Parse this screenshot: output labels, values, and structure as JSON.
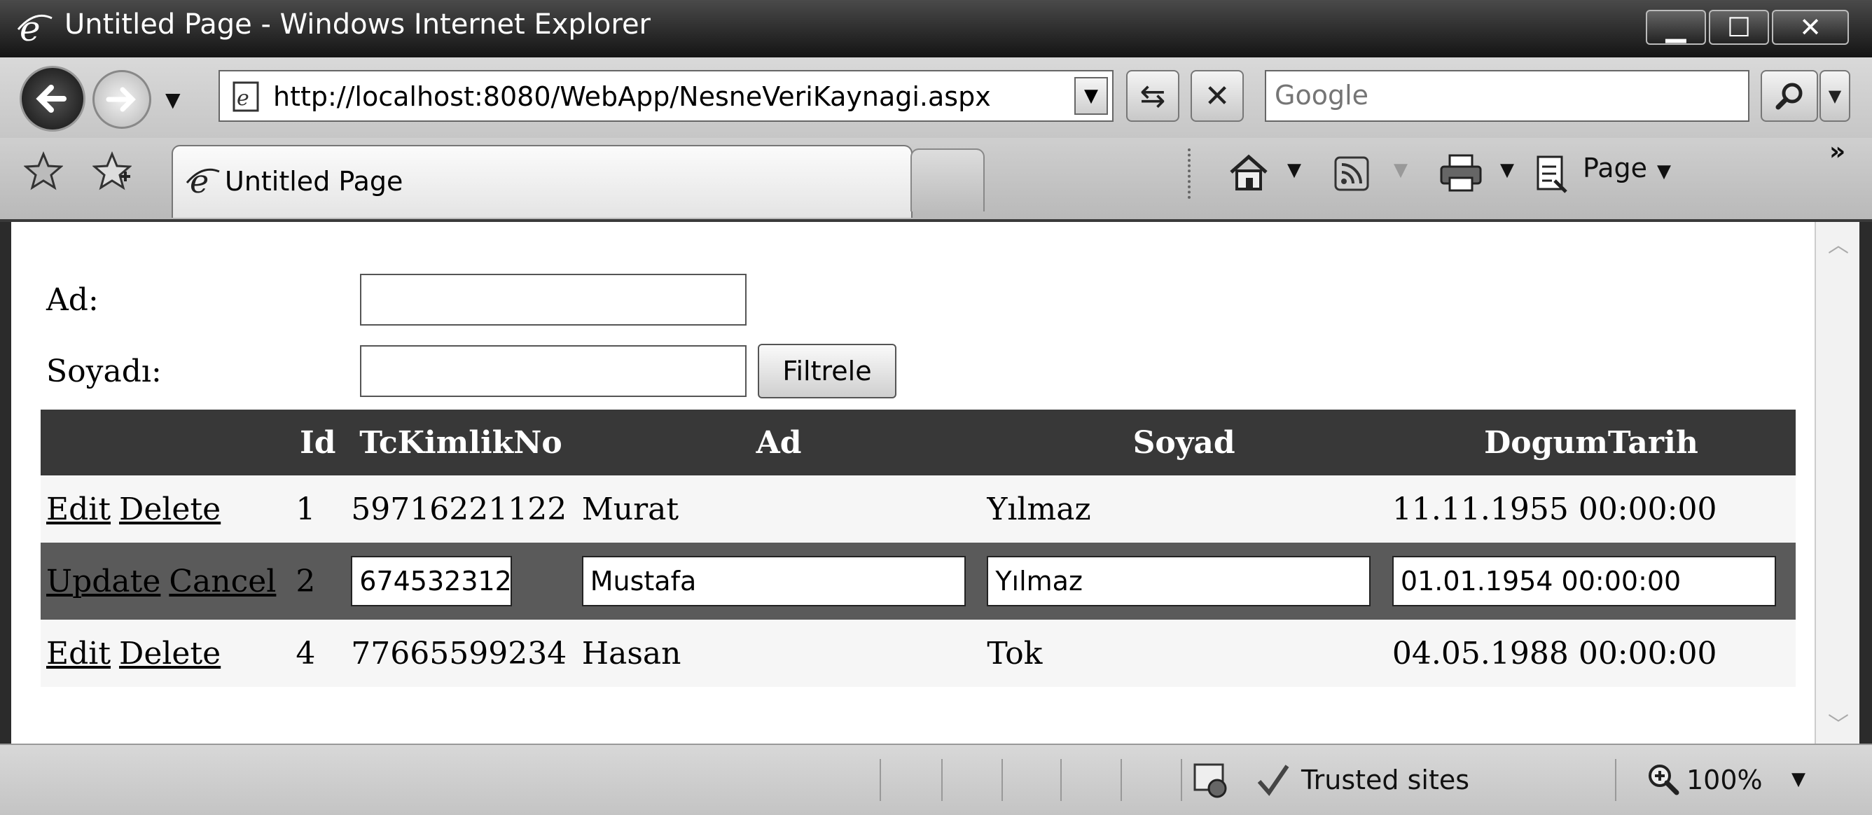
{
  "window": {
    "title": "Untitled Page - Windows Internet Explorer",
    "minimize": "▁",
    "maximize": "☐",
    "close": "✕"
  },
  "nav": {
    "url": "http://localhost:8080/WebApp/NesneVeriKaynagi.aspx",
    "search_placeholder": "Google"
  },
  "tabs": [
    {
      "label": "Untitled Page"
    }
  ],
  "commands": {
    "page_label": "Page"
  },
  "form": {
    "ad_label": "Ad:",
    "soyadi_label": "Soyadı:",
    "ad_value": "",
    "soyadi_value": "",
    "filter_button": "Filtrele"
  },
  "grid": {
    "columns": [
      "",
      "Id",
      "TcKimlikNo",
      "Ad",
      "Soyad",
      "DogumTarih"
    ],
    "rows": [
      {
        "mode": "view",
        "action1": "Edit",
        "action2": "Delete",
        "id": "1",
        "tc": "59716221122",
        "ad": "Murat",
        "soyad": "Yılmaz",
        "dogum": "11.11.1955 00:00:00"
      },
      {
        "mode": "edit",
        "action1": "Update",
        "action2": "Cancel",
        "id": "2",
        "tc": "674532312",
        "ad": "Mustafa",
        "soyad": "Yılmaz",
        "dogum": "01.01.1954 00:00:00"
      },
      {
        "mode": "view",
        "action1": "Edit",
        "action2": "Delete",
        "id": "4",
        "tc": "77665599234",
        "ad": "Hasan",
        "soyad": "Tok",
        "dogum": "04.05.1988 00:00:00"
      }
    ]
  },
  "status": {
    "zone": "Trusted sites",
    "zoom": "100%"
  },
  "icons": [
    "ie-logo-icon",
    "back-arrow-icon",
    "forward-arrow-icon",
    "recent-pages-dropdown-icon",
    "page-icon",
    "address-dropdown-icon",
    "refresh-icon",
    "stop-icon",
    "search-magnifier-icon",
    "search-options-icon",
    "favorites-star-icon",
    "add-favorites-icon",
    "tab-page-icon",
    "home-icon",
    "feeds-icon",
    "print-icon",
    "page-menu-icon",
    "chevron-more-icon",
    "protected-mode-icon",
    "trusted-check-icon",
    "zoom-icon"
  ]
}
